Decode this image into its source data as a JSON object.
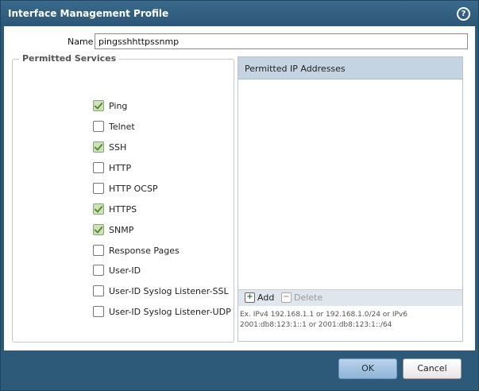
{
  "dialog": {
    "title": "Interface Management Profile",
    "help_icon": "help-icon",
    "help_glyph": "?"
  },
  "name_field": {
    "label": "Name",
    "value": "pingsshhttpssnmp"
  },
  "permitted_services": {
    "legend": "Permitted Services",
    "items": [
      {
        "label": "Ping",
        "checked": true
      },
      {
        "label": "Telnet",
        "checked": false
      },
      {
        "label": "SSH",
        "checked": true
      },
      {
        "label": "HTTP",
        "checked": false
      },
      {
        "label": "HTTP OCSP",
        "checked": false
      },
      {
        "label": "HTTPS",
        "checked": true
      },
      {
        "label": "SNMP",
        "checked": true
      },
      {
        "label": "Response Pages",
        "checked": false
      },
      {
        "label": "User-ID",
        "checked": false
      },
      {
        "label": "User-ID Syslog Listener-SSL",
        "checked": false
      },
      {
        "label": "User-ID Syslog Listener-UDP",
        "checked": false
      }
    ]
  },
  "ip_panel": {
    "header": "Permitted IP Addresses",
    "add_label": "Add",
    "add_glyph": "+",
    "delete_label": "Delete",
    "delete_glyph": "−",
    "hint": "Ex. IPv4 192.168.1.1 or 192.168.1.0/24 or IPv6 2001:db8:123:1::1 or 2001:db8:123:1::/64"
  },
  "footer": {
    "ok_label": "OK",
    "cancel_label": "Cancel"
  },
  "colors": {
    "frame": "#2e5a7a",
    "ip_header": "#c5d4e3",
    "checked_fill": "#cfe3b8"
  }
}
